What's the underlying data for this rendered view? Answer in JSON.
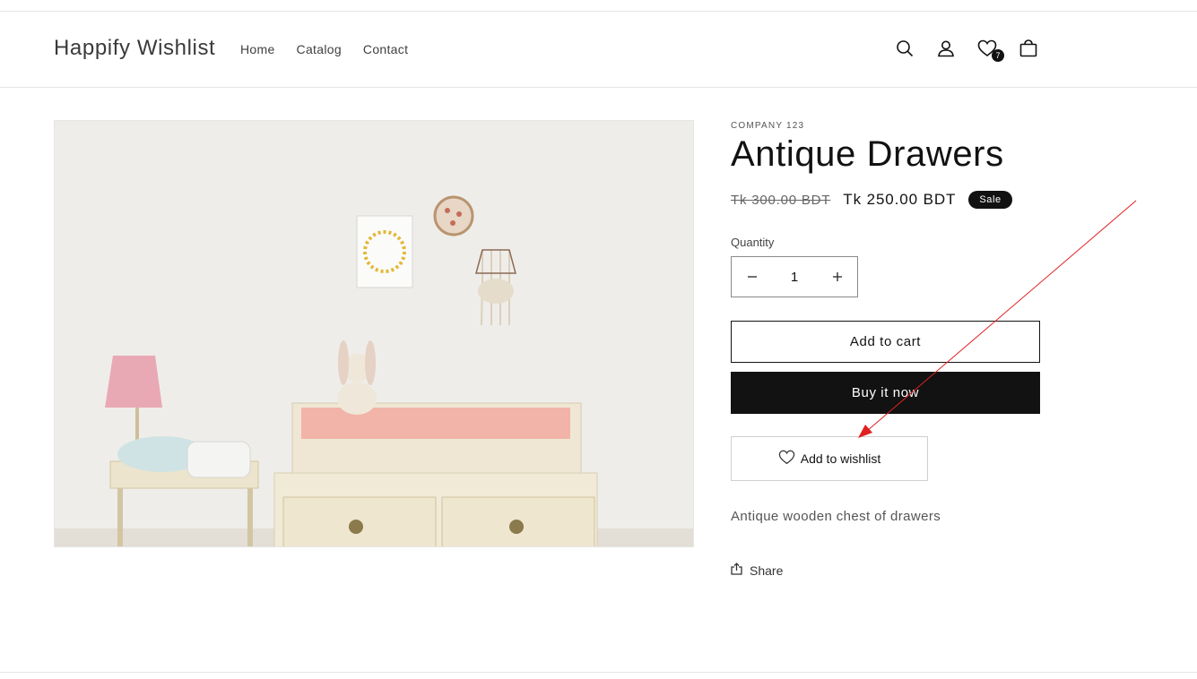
{
  "header": {
    "logo": "Happify Wishlist",
    "nav": [
      "Home",
      "Catalog",
      "Contact"
    ],
    "wishlist_count": "7",
    "icons": [
      "search-icon",
      "account-icon",
      "wishlist-heart-icon",
      "cart-icon"
    ]
  },
  "product": {
    "vendor": "COMPANY 123",
    "title": "Antique Drawers",
    "price_old": "Tk 300.00 BDT",
    "price_new": "Tk 250.00 BDT",
    "sale_label": "Sale",
    "quantity_label": "Quantity",
    "quantity_value": "1",
    "add_to_cart": "Add to cart",
    "buy_now": "Buy it now",
    "add_to_wishlist": "Add to wishlist",
    "description": "Antique wooden chest of drawers",
    "share": "Share"
  },
  "colors": {
    "text": "#121212",
    "annotation_arrow": "#e02020"
  }
}
